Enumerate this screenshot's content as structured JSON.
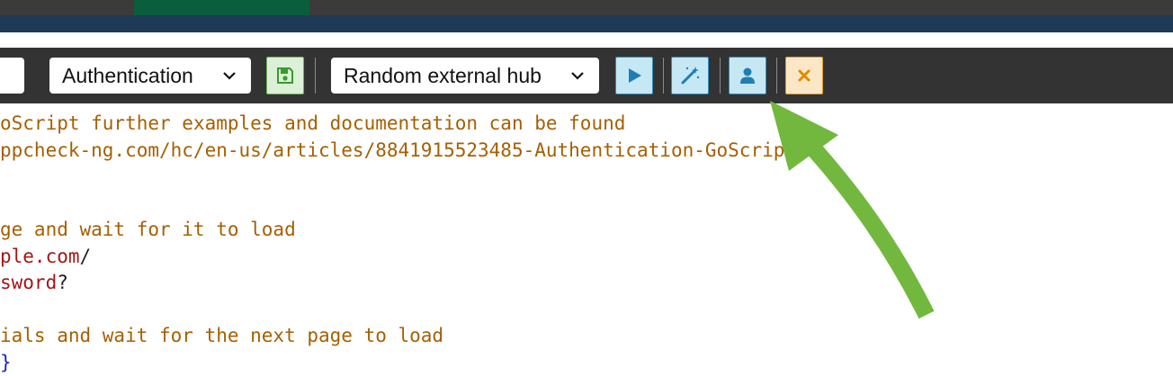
{
  "toolbar": {
    "script_type_select": {
      "selected": "Authentication"
    },
    "hub_select": {
      "selected": "Random external hub"
    },
    "buttons": {
      "save": {
        "icon": "save-icon",
        "color": "#3a9a2e"
      },
      "run": {
        "icon": "play-icon",
        "color": "#1f7fb3"
      },
      "wand": {
        "icon": "magic-wand-icon",
        "color": "#1f7fb3"
      },
      "user": {
        "icon": "user-icon",
        "color": "#1f7fb3"
      },
      "close": {
        "icon": "close-icon",
        "color": "#e08a00"
      }
    }
  },
  "editor": {
    "lines": [
      {
        "segments": [
          {
            "text": "oScript further examples and documentation can be found",
            "kind": "comment"
          }
        ]
      },
      {
        "segments": [
          {
            "text": "ppcheck-ng.com/hc/en-us/articles/8841915523485-Authentication-GoScripts",
            "kind": "comment"
          }
        ]
      },
      {
        "segments": []
      },
      {
        "segments": []
      },
      {
        "segments": [
          {
            "text": "ge and wait for it to load",
            "kind": "comment"
          }
        ]
      },
      {
        "segments": [
          {
            "text": "ple.com",
            "kind": "string"
          },
          {
            "text": "/",
            "kind": "plain"
          }
        ]
      },
      {
        "segments": [
          {
            "text": "sword",
            "kind": "string"
          },
          {
            "text": "?",
            "kind": "plain"
          }
        ]
      },
      {
        "segments": []
      },
      {
        "segments": [
          {
            "text": "ials and wait for the next page to load",
            "kind": "comment"
          }
        ]
      },
      {
        "segments": [
          {
            "text": "}",
            "kind": "brace"
          }
        ]
      }
    ]
  },
  "annotation": {
    "arrow_color": "#72b83e"
  }
}
